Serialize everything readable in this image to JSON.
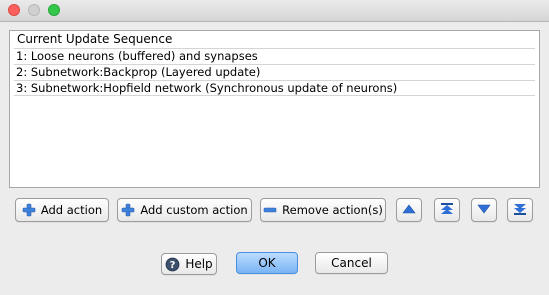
{
  "window": {
    "controls": [
      "close",
      "minimize",
      "maximize"
    ]
  },
  "sequence": {
    "title": "Current Update Sequence",
    "items": [
      "1: Loose neurons (buffered) and synapses",
      "2: Subnetwork:Backprop (Layered update)",
      "3: Subnetwork:Hopfield network (Synchronous update of neurons)"
    ]
  },
  "actions": {
    "add": "Add action",
    "add_custom": "Add custom action",
    "remove": "Remove action(s)",
    "move_up_icon": "arrow-up-icon",
    "move_top_icon": "arrow-top-icon",
    "move_down_icon": "arrow-down-icon",
    "move_bottom_icon": "arrow-bottom-icon"
  },
  "dialog": {
    "help": "Help",
    "ok": "OK",
    "cancel": "Cancel"
  },
  "colors": {
    "accent_blue": "#2f6fd6",
    "ok_button": "#79b4f6",
    "close_red": "#fc605c",
    "maximize_green": "#34c84a"
  }
}
